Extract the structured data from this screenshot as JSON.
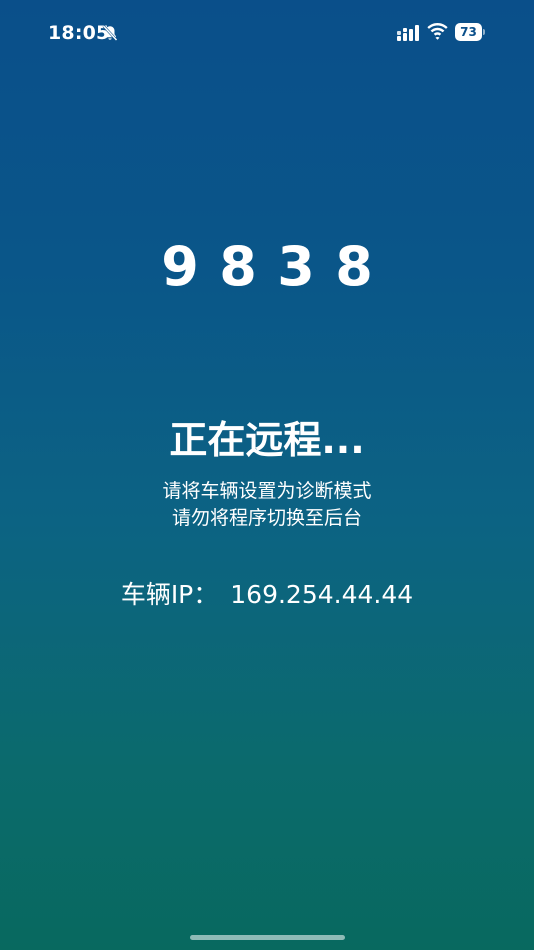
{
  "status_bar": {
    "time": "18:05",
    "battery_level": "73",
    "icons": [
      "bell-off-icon",
      "signal-icon",
      "wifi-icon",
      "battery-icon"
    ]
  },
  "main": {
    "code_digits": [
      "9",
      "8",
      "3",
      "8"
    ],
    "title": "正在远程...",
    "hint_line_1": "请将车辆设置为诊断模式",
    "hint_line_2": "请勿将程序切换至后台",
    "ip_label": "车辆IP：",
    "ip_value": "169.254.44.44"
  },
  "colors": {
    "gradient_top": "#0a4f8a",
    "gradient_bottom": "#08695f",
    "text": "#ffffff"
  }
}
